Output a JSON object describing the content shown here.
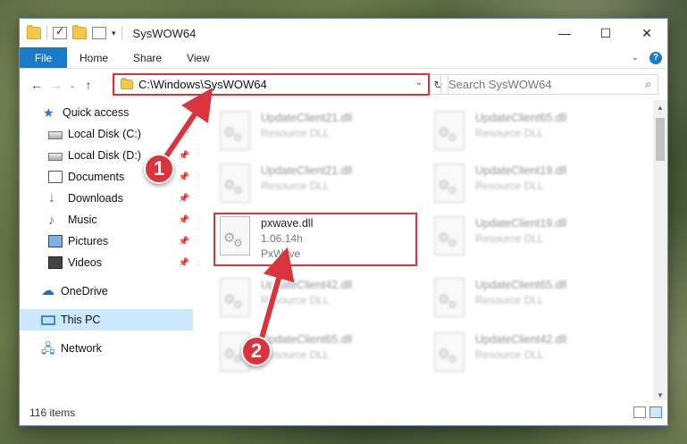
{
  "window": {
    "title": "SysWOW64",
    "controls": {
      "minimize": "—",
      "maximize": "☐",
      "close": "✕"
    }
  },
  "ribbon": {
    "tabs": [
      "File",
      "Home",
      "Share",
      "View"
    ]
  },
  "nav": {
    "address": "C:\\Windows\\SysWOW64",
    "search_placeholder": "Search SysWOW64"
  },
  "sidebar": {
    "items": [
      {
        "label": "Quick access",
        "icon": "star-icon"
      },
      {
        "label": "Local Disk (C:)",
        "icon": "disk-icon"
      },
      {
        "label": "Local Disk (D:)",
        "icon": "disk-icon"
      },
      {
        "label": "Documents",
        "icon": "documents-icon"
      },
      {
        "label": "Downloads",
        "icon": "downloads-icon"
      },
      {
        "label": "Music",
        "icon": "music-icon"
      },
      {
        "label": "Pictures",
        "icon": "pictures-icon"
      },
      {
        "label": "Videos",
        "icon": "videos-icon"
      },
      {
        "label": "OneDrive",
        "icon": "onedrive-icon"
      },
      {
        "label": "This PC",
        "icon": "this-pc-icon"
      },
      {
        "label": "Network",
        "icon": "network-icon"
      }
    ]
  },
  "files": [
    {
      "name": "UpdateClient21.dll",
      "desc": "Resource DLL"
    },
    {
      "name": "UpdateClient65.dll",
      "desc": "Resource DLL"
    },
    {
      "name": "UpdateClient21.dll",
      "desc": "Resource DLL"
    },
    {
      "name": "UpdateClient19.dll",
      "desc": "Resource DLL"
    },
    {
      "name": "pxwave.dll",
      "version": "1.06.14h",
      "desc": "PxWave"
    },
    {
      "name": "UpdateClient19.dll",
      "desc": "Resource DLL"
    },
    {
      "name": "UpdateClient42.dll",
      "desc": "Resource DLL"
    },
    {
      "name": "UpdateClient65.dll",
      "desc": "Resource DLL"
    },
    {
      "name": "UpdateClient65.dll",
      "desc": "Resource DLL"
    },
    {
      "name": "UpdateClient42.dll",
      "desc": "Resource DLL"
    }
  ],
  "status": {
    "items_count": "116 items"
  },
  "callouts": {
    "one": "1",
    "two": "2"
  },
  "colors": {
    "accent": "#1979ca",
    "highlight": "#d9343b"
  }
}
